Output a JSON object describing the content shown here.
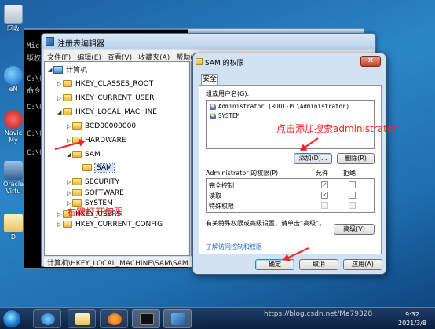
{
  "desktop": {
    "icons": [
      {
        "label": "回收",
        "icon": "recycle-bin-icon"
      },
      {
        "label": "eN",
        "icon": "internet-explorer-icon"
      },
      {
        "label": "Navic\nMy",
        "icon": "navicat-icon"
      },
      {
        "label": "Oracle\nVirtu",
        "icon": "virtualbox-icon"
      },
      {
        "label": "D",
        "icon": "folder-icon"
      }
    ]
  },
  "console": {
    "lines": [
      "Micr",
      "版权",
      "C:\\U",
      "命令",
      "C:\\U",
      "C:\\U",
      "C:\\U"
    ]
  },
  "regedit": {
    "title": "注册表编辑器",
    "menu": [
      "文件(F)",
      "编辑(E)",
      "查看(V)",
      "收藏夹(A)",
      "帮助(H)"
    ],
    "tree": {
      "root": "计算机",
      "items": [
        "HKEY_CLASSES_ROOT",
        "HKEY_CURRENT_USER",
        "HKEY_LOCAL_MACHINE",
        "BCD00000000",
        "HARDWARE",
        "SAM",
        "SAM",
        "SECURITY",
        "SOFTWARE",
        "SYSTEM",
        "HKEY_USERS",
        "HKEY_CURRENT_CONFIG"
      ]
    },
    "status": "计算机\\HKEY_LOCAL_MACHINE\\SAM\\SAM"
  },
  "dialog": {
    "title": "SAM 的权限",
    "tab": "安全",
    "group_label": "组或用户名(G):",
    "users": [
      "Administrator (ROOT-PC\\Administrator)",
      "SYSTEM"
    ],
    "add_button": "添加(D)...",
    "remove_button": "删除(R)",
    "perm_label": "Administrator 的权限(P)",
    "allow_header": "允许",
    "deny_header": "拒绝",
    "permissions": [
      {
        "name": "完全控制",
        "allow": "✓",
        "deny": ""
      },
      {
        "name": "读取",
        "allow": "✓",
        "deny": ""
      },
      {
        "name": "特殊权限",
        "allow": "",
        "deny": ""
      }
    ],
    "advanced_text": "有关特殊权限或高级设置，请单击“高级”。",
    "advanced_button": "高级(V)",
    "link": "了解访问控制和权限",
    "ok_button": "确定",
    "cancel_button": "取消",
    "apply_button": "应用(A)"
  },
  "annotations": {
    "right_click": "右键打开权限",
    "click_add": "点击添加搜索administrator"
  },
  "taskbar": {
    "time": "9:32",
    "date": "2021/3/8"
  },
  "watermark": "https://blog.csdn.net/Ma79328"
}
